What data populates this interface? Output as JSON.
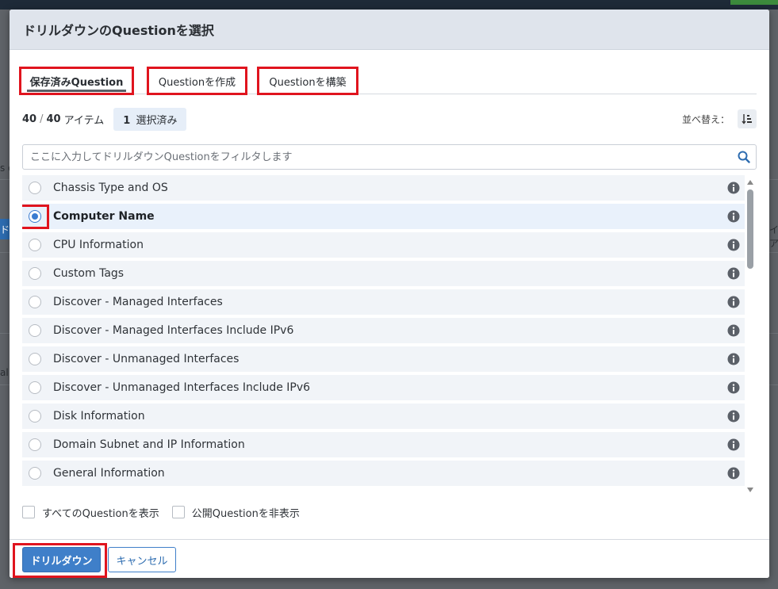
{
  "background": {
    "left_labels": [
      "s o",
      "ドル",
      "al"
    ],
    "right_labels": [
      "イア"
    ]
  },
  "modal": {
    "title": "ドリルダウンのQuestionを選択",
    "tabs": [
      {
        "label": "保存済みQuestion",
        "active": true
      },
      {
        "label": "Questionを作成",
        "active": false
      },
      {
        "label": "Questionを構築",
        "active": false
      }
    ],
    "count": {
      "shown": "40",
      "separator": "/",
      "total": "40",
      "unit": "アイテム"
    },
    "selected_badge": {
      "count": "1",
      "label": "選択済み"
    },
    "sort": {
      "label": "並べ替え：",
      "icon": "sort-icon"
    },
    "search": {
      "placeholder": "ここに入力してドリルダウンQuestionをフィルタします",
      "value": "",
      "icon": "search-icon"
    },
    "list_items": [
      {
        "label": "Chassis Type and OS",
        "selected": false
      },
      {
        "label": "Computer Name",
        "selected": true
      },
      {
        "label": "CPU Information",
        "selected": false
      },
      {
        "label": "Custom Tags",
        "selected": false
      },
      {
        "label": "Discover - Managed Interfaces",
        "selected": false
      },
      {
        "label": "Discover - Managed Interfaces Include IPv6",
        "selected": false
      },
      {
        "label": "Discover - Unmanaged Interfaces",
        "selected": false
      },
      {
        "label": "Discover - Unmanaged Interfaces Include IPv6",
        "selected": false
      },
      {
        "label": "Disk Information",
        "selected": false
      },
      {
        "label": "Domain Subnet and IP Information",
        "selected": false
      },
      {
        "label": "General Information",
        "selected": false
      }
    ],
    "checkboxes": [
      {
        "label": "すべてのQuestionを表示",
        "checked": false
      },
      {
        "label": "公開Questionを非表示",
        "checked": false
      }
    ],
    "buttons": {
      "primary": "ドリルダウン",
      "secondary": "キャンセル"
    },
    "colors": {
      "primary": "#3f7fc9",
      "highlight_annotation": "#e0141e",
      "header_bg": "#dfe4ec"
    }
  }
}
